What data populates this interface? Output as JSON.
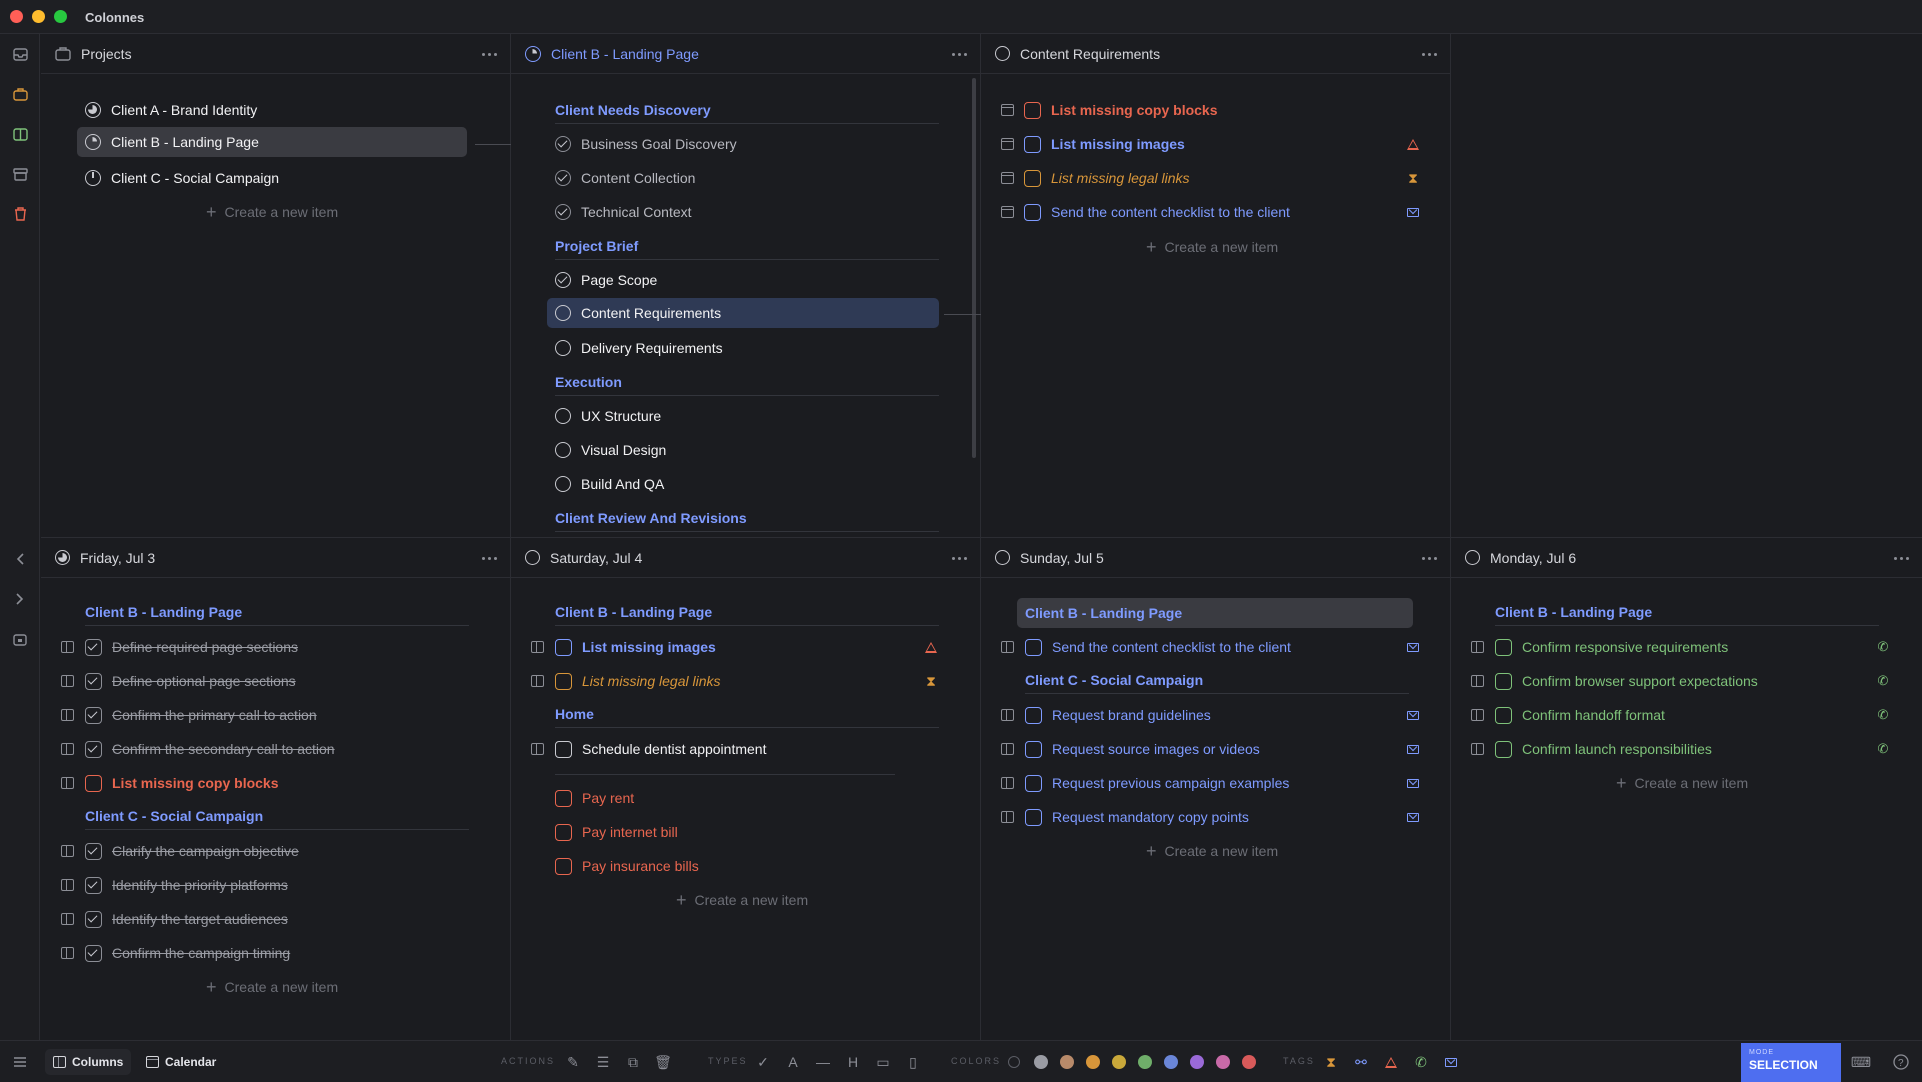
{
  "app": {
    "title": "Colonnes"
  },
  "colors": {
    "accent": "#4e6ef0",
    "section": "#7f9bff",
    "red": "#e8664f",
    "orange": "#d8963a",
    "green": "#7fc27a"
  },
  "projects": {
    "title": "Projects",
    "items": [
      {
        "label": "Client A - Brand Identity"
      },
      {
        "label": "Client B - Landing Page"
      },
      {
        "label": "Client C - Social Campaign"
      }
    ],
    "create": "Create a new item"
  },
  "landing": {
    "title": "Client B - Landing Page",
    "sections": [
      {
        "label": "Client Needs Discovery",
        "items": [
          "Business Goal Discovery",
          "Content Collection",
          "Technical Context"
        ]
      },
      {
        "label": "Project Brief",
        "items": [
          "Page Scope",
          "Content Requirements",
          "Delivery Requirements"
        ]
      },
      {
        "label": "Execution",
        "items": [
          "UX Structure",
          "Visual Design",
          "Build And QA"
        ]
      },
      {
        "label": "Client Review And Revisions",
        "items": []
      }
    ]
  },
  "content": {
    "title": "Content Requirements",
    "items": [
      "List missing copy blocks",
      "List missing images",
      "List missing legal links",
      "Send the content checklist to the client"
    ],
    "create": "Create a new item"
  },
  "day1": {
    "title": "Friday, Jul 3",
    "groupA": "Client B - Landing Page",
    "itemsA": [
      "Define required page sections",
      "Define optional page sections",
      "Confirm the primary call to action",
      "Confirm the secondary call to action",
      "List missing copy blocks"
    ],
    "groupB": "Client C - Social Campaign",
    "itemsB": [
      "Clarify the campaign objective",
      "Identify the priority platforms",
      "Identify the target audiences",
      "Confirm the campaign timing"
    ],
    "create": "Create a new item"
  },
  "day2": {
    "title": "Saturday, Jul 4",
    "groupA": "Client B - Landing Page",
    "itemsA": [
      "List missing images",
      "List missing legal links"
    ],
    "groupB": "Home",
    "itemsB": [
      "Schedule dentist appointment"
    ],
    "bills": [
      "Pay rent",
      "Pay internet bill",
      "Pay insurance bills"
    ],
    "create": "Create a new item"
  },
  "day3": {
    "title": "Sunday, Jul 5",
    "groupA": "Client B - Landing Page",
    "itemsA": [
      "Send the content checklist to the client"
    ],
    "groupB": "Client C - Social Campaign",
    "itemsB": [
      "Request brand guidelines",
      "Request source images or videos",
      "Request previous campaign examples",
      "Request mandatory copy points"
    ],
    "create": "Create a new item"
  },
  "day4": {
    "title": "Monday, Jul 6",
    "groupA": "Client B - Landing Page",
    "itemsA": [
      "Confirm responsive requirements",
      "Confirm browser support expectations",
      "Confirm handoff format",
      "Confirm launch responsibilities"
    ],
    "create": "Create a new item"
  },
  "bottombar": {
    "columns": "Columns",
    "calendar": "Calendar",
    "actions": "ACTIONS",
    "types": "TYPES",
    "colors": "COLORS",
    "tags": "TAGS",
    "mode_label": "MODE",
    "mode_value": "SELECTION",
    "swatches": [
      "#9a9ca4",
      "#b88a6a",
      "#d8963a",
      "#c9a83a",
      "#6fae6a",
      "#6a86d8",
      "#9a6ad8",
      "#c86aa8",
      "#d85a5a"
    ]
  }
}
